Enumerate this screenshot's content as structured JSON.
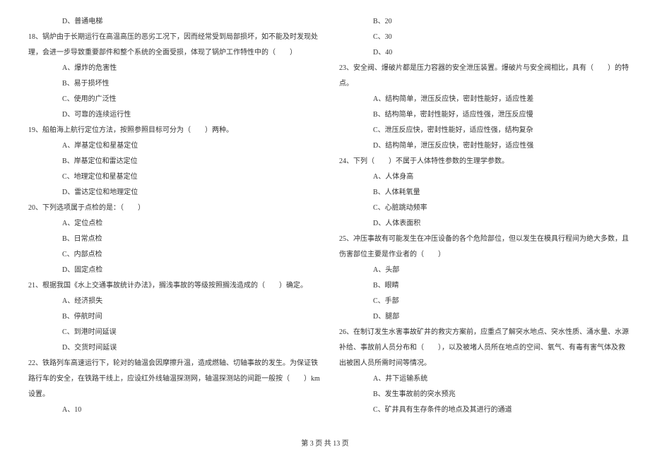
{
  "left": {
    "opt_d_17": "D、普通电梯",
    "q18_a": "18、锅炉由于长期运行在高温高压的恶劣工况下，因而经常受到局部损坏，如不能及时发现处",
    "q18_b": "理，会进一步导致重要部件和整个系统的全面受损，体现了锅炉工作特性中的（　　）",
    "q18_opts": {
      "a": "A、爆炸的危害性",
      "b": "B、易于损坏性",
      "c": "C、使用的广泛性",
      "d": "D、可靠的连续运行性"
    },
    "q19": "19、船舶海上航行定位方法，按照参照目标可分为（　　）两种。",
    "q19_opts": {
      "a": "A、岸基定位和星基定位",
      "b": "B、岸基定位和雷达定位",
      "c": "C、地理定位和星基定位",
      "d": "D、雷达定位和地理定位"
    },
    "q20": "20、下列选项属于点检的是：（　　）",
    "q20_opts": {
      "a": "A、定位点检",
      "b": "B、日常点检",
      "c": "C、内部点检",
      "d": "D、固定点检"
    },
    "q21": "21、根据我国《水上交通事故统计办法》，搁浅事故的等级按照搁浅造成的（　　）确定。",
    "q21_opts": {
      "a": "A、经济损失",
      "b": "B、停航时间",
      "c": "C、到港时间延误",
      "d": "D、交货时间延误"
    },
    "q22_a": "22、铁路列车高速运行下，轮对的轴温会因摩擦升温，造成燃轴、切轴事故的发生。为保证铁",
    "q22_b": "路行车的安全，在铁路干线上，应设红外线轴温探测网，轴温探测站的间距一般按（　　）km",
    "q22_c": "设置。",
    "q22_opts": {
      "a": "A、10"
    }
  },
  "right": {
    "q22_opts": {
      "b": "B、20",
      "c": "C、30",
      "d": "D、40"
    },
    "q23_a": "23、安全阀、爆破片都是压力容器的安全泄压装置。爆破片与安全阀相比，具有（　　）的特",
    "q23_b": "点。",
    "q23_opts": {
      "a": "A、结构简单，泄压反应快，密封性能好，适应性差",
      "b": "B、结构简单，密封性能好，适应性强，泄压反应慢",
      "c": "C、泄压反应快，密封性能好，适应性强，结构复杂",
      "d": "D、结构简单，泄压反应快，密封性能好，适应性强"
    },
    "q24": "24、下列（　　）不属于人体特性参数的生理学参数。",
    "q24_opts": {
      "a": "A、人体身高",
      "b": "B、人体耗氧量",
      "c": "C、心脏跳动频率",
      "d": "D、人体表面积"
    },
    "q25_a": "25、冲压事故有可能发生在冲压设备的各个危险部位，但以发生在模具行程间为绝大多数，且",
    "q25_b": "伤害部位主要是作业者的（　　）",
    "q25_opts": {
      "a": "A、头部",
      "b": "B、眼睛",
      "c": "C、手部",
      "d": "D、腿部"
    },
    "q26_a": "26、在制订发生水害事故矿井的救灾方案前，应重点了解突水地点、突水性质、涌水量、水源",
    "q26_b": "补给、事故前人员分布和（　　），以及被堵人员所在地点的空间、氧气、有毒有害气体及救",
    "q26_c": "出被困人员所需时间等情况。",
    "q26_opts": {
      "a": "A、井下运输系统",
      "b": "B、发生事故前的突水预兆",
      "c": "C、矿井具有生存条件的地点及其进行的通道"
    }
  },
  "footer": "第 3 页 共 13 页"
}
